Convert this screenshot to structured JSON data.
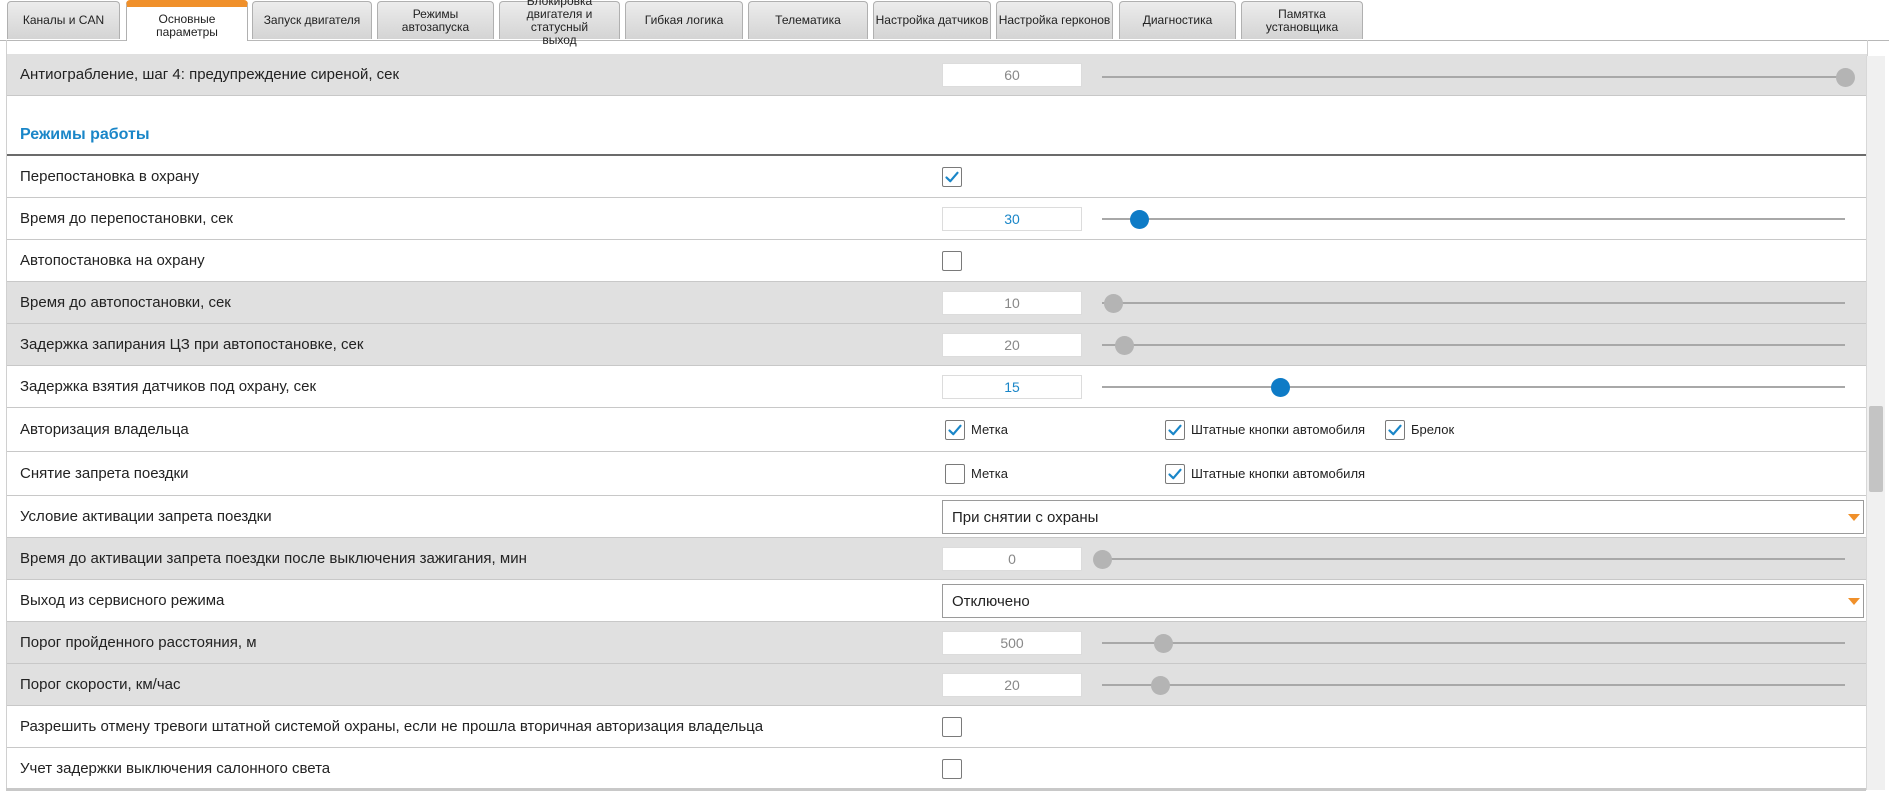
{
  "tabs": [
    {
      "label": "Каналы и CAN"
    },
    {
      "label": "Основные параметры"
    },
    {
      "label": "Запуск двигателя"
    },
    {
      "label": "Режимы автозапуска"
    },
    {
      "label": "Блокировка двигателя и статусный выход"
    },
    {
      "label": "Гибкая логика"
    },
    {
      "label": "Телематика"
    },
    {
      "label": "Настройка датчиков"
    },
    {
      "label": "Настройка герконов"
    },
    {
      "label": "Диагностика"
    },
    {
      "label": "Памятка установщика"
    }
  ],
  "active_tab": "Основные параметры",
  "top_row": {
    "label": "Антиограбление, шаг 4: предупреждение сиреной, сек",
    "value": "60",
    "slider_fraction": 1.0
  },
  "section": {
    "title": "Режимы работы"
  },
  "rows": {
    "repostanovka": {
      "label": "Перепостановка в охрану",
      "checked": true
    },
    "vremya_repostanovki": {
      "label": "Время до перепостановки, сек",
      "value": "30",
      "slider_fraction": 0.05
    },
    "avtopostanovka": {
      "label": "Автопостановка на охрану",
      "checked": false
    },
    "vremya_avtopostanovki": {
      "label": "Время до автопостановки, сек",
      "value": "10",
      "slider_fraction": 0.015
    },
    "zaderzhka_cz": {
      "label": "Задержка запирания ЦЗ при автопостановке, сек",
      "value": "20",
      "slider_fraction": 0.03
    },
    "zaderzhka_datchikov": {
      "label": "Задержка взятия датчиков под охрану, сек",
      "value": "15",
      "slider_fraction": 0.24
    },
    "avtorizaciya": {
      "label": "Авторизация владельца",
      "options": [
        {
          "label": "Метка",
          "checked": true
        },
        {
          "label": "Штатные кнопки автомобиля",
          "checked": true
        },
        {
          "label": "Брелок",
          "checked": true
        }
      ]
    },
    "snyatie_zapreta": {
      "label": "Снятие запрета поездки",
      "options": [
        {
          "label": "Метка",
          "checked": false
        },
        {
          "label": "Штатные кнопки автомобиля",
          "checked": true
        }
      ]
    },
    "uslovie_aktivacii": {
      "label": "Условие активации запрета поездки",
      "selected": "При снятии с охраны"
    },
    "vremya_do_aktivacii": {
      "label": "Время до активации запрета поездки после выключения зажигания, мин",
      "value": "0",
      "slider_fraction": 0.0
    },
    "vyhod_iz_servisnogo": {
      "label": "Выход из сервисного режима",
      "selected": "Отключено"
    },
    "porog_rasstoyaniya": {
      "label": "Порог пройденного расстояния, м",
      "value": "500",
      "slider_fraction": 0.082
    },
    "porog_skorosti": {
      "label": "Порог скорости, км/час",
      "value": "20",
      "slider_fraction": 0.078
    },
    "razreshit_otmenu": {
      "label": "Разрешить отмену тревоги штатной системой охраны, если не прошла вторичная авторизация владельца",
      "checked": false
    },
    "uchet_zaderzhki": {
      "label": "Учет задержки выключения салонного света",
      "checked": false
    }
  },
  "colors": {
    "accent": "#1a86c8",
    "tab_active": "#f0902a",
    "row_grey": "#e0e0e0"
  }
}
